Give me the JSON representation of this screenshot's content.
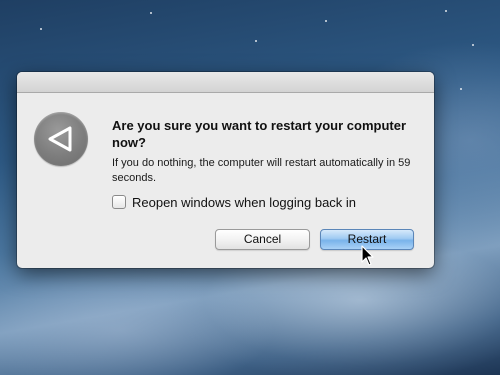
{
  "dialog": {
    "title": "Are you sure you want to restart your computer now?",
    "message": "If you do nothing, the computer will restart automatically in 59 seconds.",
    "app_icon": "restart-triangle-icon",
    "checkbox": {
      "label": "Reopen windows when logging back in",
      "checked": false
    },
    "buttons": {
      "cancel_label": "Cancel",
      "restart_label": "Restart"
    }
  },
  "colors": {
    "default_button": "#8fc1ef",
    "dialog_background": "#ececec"
  }
}
